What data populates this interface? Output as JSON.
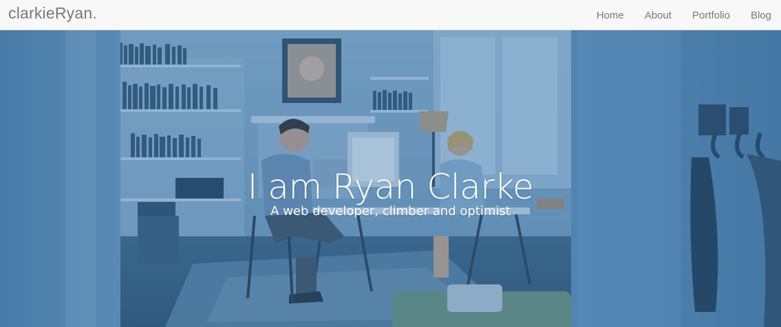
{
  "navbar": {
    "brand": "clarkieRyan.",
    "links": [
      "Home",
      "About",
      "Portfolio",
      "Blog"
    ]
  },
  "hero": {
    "title": "I am Ryan Clarke",
    "subtitle": "A web developer, climber and optimist",
    "background_image": "office-scene-with-two-people-at-desks",
    "overlay_color": "#3a76a8"
  },
  "colors": {
    "navbar_bg": "#f8f8f8",
    "nav_text": "#777777",
    "hero_tint": "#3f6e96",
    "hero_text": "#ffffff"
  }
}
